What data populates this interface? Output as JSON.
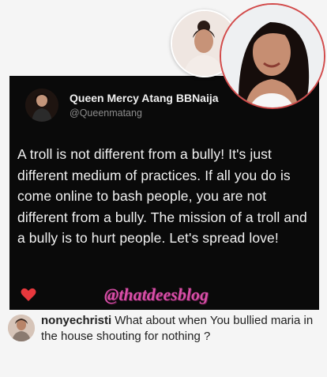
{
  "tweet": {
    "name": "Queen Mercy Atang BBNaija",
    "handle": "@Queenmatang",
    "text": "A troll is not different from a bully! It's just different medium of practices. If all you do is come online to bash people, you are not different from a bully. The mission of a troll and a bully is to hurt people. Let's spread love!",
    "heart_color": "#e8383d"
  },
  "watermark": "@thatdeesblog",
  "comment": {
    "username": "nonyechristi",
    "text": "What about when You bullied maria in the house shouting for nothing ?"
  },
  "colors": {
    "card_background": "#0a0a0a",
    "watermark": "#d94fa8",
    "photo_ring": "#d24a4a"
  }
}
